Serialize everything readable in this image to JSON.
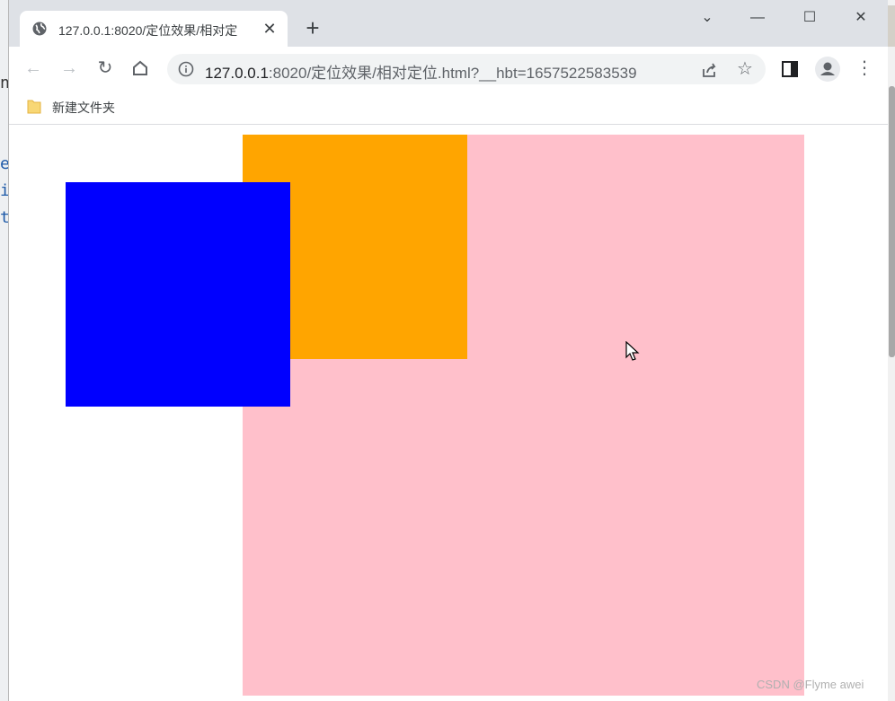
{
  "browser": {
    "tab_title": "127.0.0.1:8020/定位效果/相对定",
    "tab_close": "✕",
    "new_tab": "+",
    "controls": {
      "dropdown": "⌄",
      "minimize": "—",
      "maximize": "☐",
      "close": "✕"
    }
  },
  "toolbar": {
    "url_host": "127.0.0.1",
    "url_rest": ":8020/定位效果/相对定位.html?__hbt=1657522583539"
  },
  "bookmarks": [
    {
      "label": "新建文件夹",
      "icon": "folder-icon"
    }
  ],
  "page": {
    "boxes": [
      {
        "name": "pink-box",
        "color": "#ffc0cb"
      },
      {
        "name": "orange-box",
        "color": "#ffa500"
      },
      {
        "name": "blue-box",
        "color": "#0000ff"
      }
    ]
  },
  "background_text": [
    "n",
    "e",
    "i",
    "t"
  ],
  "watermark": "CSDN @Flyme awei"
}
